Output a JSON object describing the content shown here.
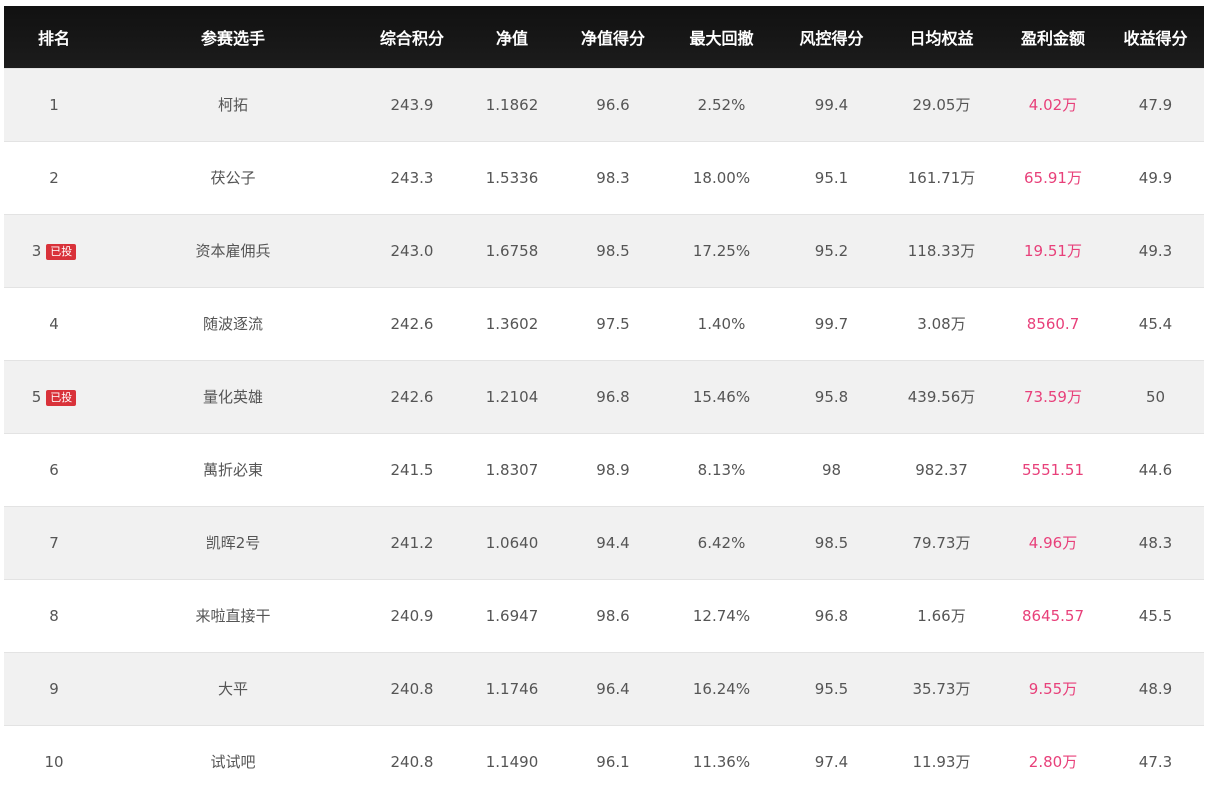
{
  "headers": [
    "排名",
    "参赛选手",
    "综合积分",
    "净值",
    "净值得分",
    "最大回撤",
    "风控得分",
    "日均权益",
    "盈利金额",
    "收益得分"
  ],
  "badge_label": "已投",
  "rows": [
    {
      "rank": "1",
      "invested": false,
      "name": "柯拓",
      "score": "243.9",
      "nav": "1.1862",
      "nav_score": "96.6",
      "drawdown": "2.52%",
      "risk_score": "99.4",
      "daily_equity": "29.05万",
      "profit": "4.02万",
      "return_score": "47.9"
    },
    {
      "rank": "2",
      "invested": false,
      "name": "茯公子",
      "score": "243.3",
      "nav": "1.5336",
      "nav_score": "98.3",
      "drawdown": "18.00%",
      "risk_score": "95.1",
      "daily_equity": "161.71万",
      "profit": "65.91万",
      "return_score": "49.9"
    },
    {
      "rank": "3",
      "invested": true,
      "name": "资本雇佣兵",
      "score": "243.0",
      "nav": "1.6758",
      "nav_score": "98.5",
      "drawdown": "17.25%",
      "risk_score": "95.2",
      "daily_equity": "118.33万",
      "profit": "19.51万",
      "return_score": "49.3"
    },
    {
      "rank": "4",
      "invested": false,
      "name": "随波逐流",
      "score": "242.6",
      "nav": "1.3602",
      "nav_score": "97.5",
      "drawdown": "1.40%",
      "risk_score": "99.7",
      "daily_equity": "3.08万",
      "profit": "8560.7",
      "return_score": "45.4"
    },
    {
      "rank": "5",
      "invested": true,
      "name": "量化英雄",
      "score": "242.6",
      "nav": "1.2104",
      "nav_score": "96.8",
      "drawdown": "15.46%",
      "risk_score": "95.8",
      "daily_equity": "439.56万",
      "profit": "73.59万",
      "return_score": "50"
    },
    {
      "rank": "6",
      "invested": false,
      "name": "萬折必東",
      "score": "241.5",
      "nav": "1.8307",
      "nav_score": "98.9",
      "drawdown": "8.13%",
      "risk_score": "98",
      "daily_equity": "982.37",
      "profit": "5551.51",
      "return_score": "44.6"
    },
    {
      "rank": "7",
      "invested": false,
      "name": "凯晖2号",
      "score": "241.2",
      "nav": "1.0640",
      "nav_score": "94.4",
      "drawdown": "6.42%",
      "risk_score": "98.5",
      "daily_equity": "79.73万",
      "profit": "4.96万",
      "return_score": "48.3"
    },
    {
      "rank": "8",
      "invested": false,
      "name": "来啦直接干",
      "score": "240.9",
      "nav": "1.6947",
      "nav_score": "98.6",
      "drawdown": "12.74%",
      "risk_score": "96.8",
      "daily_equity": "1.66万",
      "profit": "8645.57",
      "return_score": "45.5"
    },
    {
      "rank": "9",
      "invested": false,
      "name": "大平",
      "score": "240.8",
      "nav": "1.1746",
      "nav_score": "96.4",
      "drawdown": "16.24%",
      "risk_score": "95.5",
      "daily_equity": "35.73万",
      "profit": "9.55万",
      "return_score": "48.9"
    },
    {
      "rank": "10",
      "invested": false,
      "name": "试试吧",
      "score": "240.8",
      "nav": "1.1490",
      "nav_score": "96.1",
      "drawdown": "11.36%",
      "risk_score": "97.4",
      "daily_equity": "11.93万",
      "profit": "2.80万",
      "return_score": "47.3"
    }
  ],
  "colors": {
    "header_bg": "#111111",
    "profit_text": "#e8407a",
    "badge_bg": "#d9323a",
    "row_alt_bg": "#f1f1f1"
  }
}
